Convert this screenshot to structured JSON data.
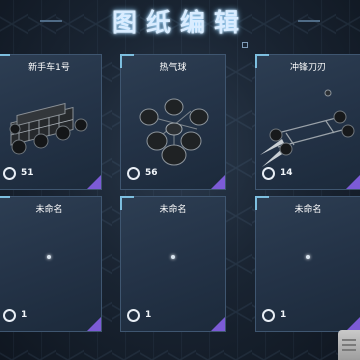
{
  "page": {
    "title": "图纸编辑"
  },
  "blueprints": [
    {
      "name": "新手车1号",
      "count": "51",
      "model_icon": "buggy-vehicle-icon"
    },
    {
      "name": "热气球",
      "count": "56",
      "model_icon": "balloon-cluster-icon"
    },
    {
      "name": "冲锋刀刃",
      "count": "14",
      "model_icon": "blade-vehicle-icon"
    },
    {
      "name": "未命名",
      "count": "1",
      "model_icon": "empty-slot-dot-icon"
    },
    {
      "name": "未命名",
      "count": "1",
      "model_icon": "empty-slot-dot-icon"
    },
    {
      "name": "未命名",
      "count": "1",
      "model_icon": "empty-slot-dot-icon"
    }
  ],
  "colors": {
    "accent_cyan": "#8fdcff",
    "accent_purple": "#7c5bd6",
    "card_background": "#2d3e53"
  }
}
